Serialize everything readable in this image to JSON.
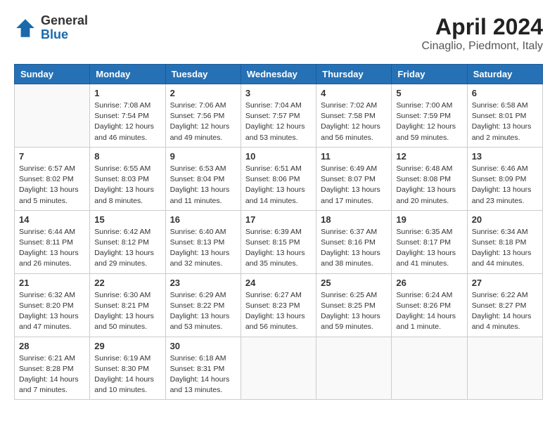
{
  "logo": {
    "general": "General",
    "blue": "Blue"
  },
  "title": "April 2024",
  "location": "Cinaglio, Piedmont, Italy",
  "days_of_week": [
    "Sunday",
    "Monday",
    "Tuesday",
    "Wednesday",
    "Thursday",
    "Friday",
    "Saturday"
  ],
  "weeks": [
    [
      {
        "day": "",
        "info": ""
      },
      {
        "day": "1",
        "info": "Sunrise: 7:08 AM\nSunset: 7:54 PM\nDaylight: 12 hours\nand 46 minutes."
      },
      {
        "day": "2",
        "info": "Sunrise: 7:06 AM\nSunset: 7:56 PM\nDaylight: 12 hours\nand 49 minutes."
      },
      {
        "day": "3",
        "info": "Sunrise: 7:04 AM\nSunset: 7:57 PM\nDaylight: 12 hours\nand 53 minutes."
      },
      {
        "day": "4",
        "info": "Sunrise: 7:02 AM\nSunset: 7:58 PM\nDaylight: 12 hours\nand 56 minutes."
      },
      {
        "day": "5",
        "info": "Sunrise: 7:00 AM\nSunset: 7:59 PM\nDaylight: 12 hours\nand 59 minutes."
      },
      {
        "day": "6",
        "info": "Sunrise: 6:58 AM\nSunset: 8:01 PM\nDaylight: 13 hours\nand 2 minutes."
      }
    ],
    [
      {
        "day": "7",
        "info": "Sunrise: 6:57 AM\nSunset: 8:02 PM\nDaylight: 13 hours\nand 5 minutes."
      },
      {
        "day": "8",
        "info": "Sunrise: 6:55 AM\nSunset: 8:03 PM\nDaylight: 13 hours\nand 8 minutes."
      },
      {
        "day": "9",
        "info": "Sunrise: 6:53 AM\nSunset: 8:04 PM\nDaylight: 13 hours\nand 11 minutes."
      },
      {
        "day": "10",
        "info": "Sunrise: 6:51 AM\nSunset: 8:06 PM\nDaylight: 13 hours\nand 14 minutes."
      },
      {
        "day": "11",
        "info": "Sunrise: 6:49 AM\nSunset: 8:07 PM\nDaylight: 13 hours\nand 17 minutes."
      },
      {
        "day": "12",
        "info": "Sunrise: 6:48 AM\nSunset: 8:08 PM\nDaylight: 13 hours\nand 20 minutes."
      },
      {
        "day": "13",
        "info": "Sunrise: 6:46 AM\nSunset: 8:09 PM\nDaylight: 13 hours\nand 23 minutes."
      }
    ],
    [
      {
        "day": "14",
        "info": "Sunrise: 6:44 AM\nSunset: 8:11 PM\nDaylight: 13 hours\nand 26 minutes."
      },
      {
        "day": "15",
        "info": "Sunrise: 6:42 AM\nSunset: 8:12 PM\nDaylight: 13 hours\nand 29 minutes."
      },
      {
        "day": "16",
        "info": "Sunrise: 6:40 AM\nSunset: 8:13 PM\nDaylight: 13 hours\nand 32 minutes."
      },
      {
        "day": "17",
        "info": "Sunrise: 6:39 AM\nSunset: 8:15 PM\nDaylight: 13 hours\nand 35 minutes."
      },
      {
        "day": "18",
        "info": "Sunrise: 6:37 AM\nSunset: 8:16 PM\nDaylight: 13 hours\nand 38 minutes."
      },
      {
        "day": "19",
        "info": "Sunrise: 6:35 AM\nSunset: 8:17 PM\nDaylight: 13 hours\nand 41 minutes."
      },
      {
        "day": "20",
        "info": "Sunrise: 6:34 AM\nSunset: 8:18 PM\nDaylight: 13 hours\nand 44 minutes."
      }
    ],
    [
      {
        "day": "21",
        "info": "Sunrise: 6:32 AM\nSunset: 8:20 PM\nDaylight: 13 hours\nand 47 minutes."
      },
      {
        "day": "22",
        "info": "Sunrise: 6:30 AM\nSunset: 8:21 PM\nDaylight: 13 hours\nand 50 minutes."
      },
      {
        "day": "23",
        "info": "Sunrise: 6:29 AM\nSunset: 8:22 PM\nDaylight: 13 hours\nand 53 minutes."
      },
      {
        "day": "24",
        "info": "Sunrise: 6:27 AM\nSunset: 8:23 PM\nDaylight: 13 hours\nand 56 minutes."
      },
      {
        "day": "25",
        "info": "Sunrise: 6:25 AM\nSunset: 8:25 PM\nDaylight: 13 hours\nand 59 minutes."
      },
      {
        "day": "26",
        "info": "Sunrise: 6:24 AM\nSunset: 8:26 PM\nDaylight: 14 hours\nand 1 minute."
      },
      {
        "day": "27",
        "info": "Sunrise: 6:22 AM\nSunset: 8:27 PM\nDaylight: 14 hours\nand 4 minutes."
      }
    ],
    [
      {
        "day": "28",
        "info": "Sunrise: 6:21 AM\nSunset: 8:28 PM\nDaylight: 14 hours\nand 7 minutes."
      },
      {
        "day": "29",
        "info": "Sunrise: 6:19 AM\nSunset: 8:30 PM\nDaylight: 14 hours\nand 10 minutes."
      },
      {
        "day": "30",
        "info": "Sunrise: 6:18 AM\nSunset: 8:31 PM\nDaylight: 14 hours\nand 13 minutes."
      },
      {
        "day": "",
        "info": ""
      },
      {
        "day": "",
        "info": ""
      },
      {
        "day": "",
        "info": ""
      },
      {
        "day": "",
        "info": ""
      }
    ]
  ]
}
